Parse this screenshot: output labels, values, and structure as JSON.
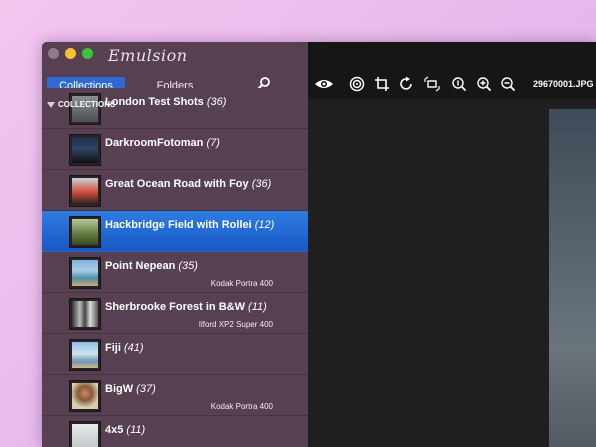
{
  "app": {
    "title": "Emulsion"
  },
  "sidebar": {
    "tabs": [
      {
        "label": "Collections",
        "active": true
      },
      {
        "label": "Folders",
        "active": false
      }
    ],
    "section_header": "COLLECTIONS",
    "collections": [
      {
        "name": "London Test Shots",
        "count": "(36)",
        "film": ""
      },
      {
        "name": "DarkroomFotoman",
        "count": "(7)",
        "film": ""
      },
      {
        "name": "Great Ocean Road with Foy",
        "count": "(36)",
        "film": ""
      },
      {
        "name": "Hackbridge Field with Rollei",
        "count": "(12)",
        "film": "",
        "selected": true
      },
      {
        "name": "Point Nepean",
        "count": "(35)",
        "film": "Kodak Portra 400"
      },
      {
        "name": "Sherbrooke Forest in B&W",
        "count": "(11)",
        "film": "Ilford XP2 Super 400"
      },
      {
        "name": "Fiji",
        "count": "(41)",
        "film": ""
      },
      {
        "name": "BigW",
        "count": "(37)",
        "film": "Kodak Portra 400"
      },
      {
        "name": "4x5",
        "count": "(11)",
        "film": ""
      }
    ]
  },
  "toolbar": {
    "file_name": "29670001.JPG",
    "tools": [
      "eye-icon",
      "target-icon",
      "crop-icon",
      "rotate-icon",
      "straighten-icon",
      "zoom-actual-icon",
      "zoom-in-icon",
      "zoom-out-icon"
    ]
  },
  "colors": {
    "sidebar_bg": "#574051",
    "selection": "#2c6fd6",
    "toolbar_bg": "#161616",
    "background": "#ecbdeb"
  }
}
